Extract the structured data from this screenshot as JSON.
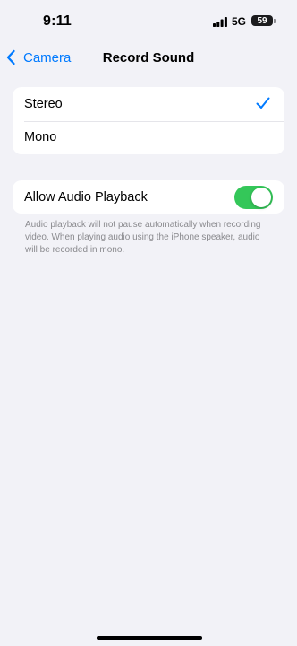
{
  "status_bar": {
    "time": "9:11",
    "network": "5G",
    "battery_level": "59",
    "icons": [
      "signal-bars-icon",
      "battery-icon"
    ]
  },
  "nav": {
    "back_label": "Camera",
    "back_icon": "chevron-left-icon",
    "title": "Record Sound"
  },
  "sound_options": {
    "items": [
      {
        "label": "Stereo",
        "selected": true
      },
      {
        "label": "Mono",
        "selected": false
      }
    ],
    "selected_icon": "checkmark-icon"
  },
  "audio_playback": {
    "label": "Allow Audio Playback",
    "enabled": true,
    "footer": "Audio playback will not pause automatically when recording video. When playing audio using the iPhone speaker, audio will be recorded in mono."
  },
  "colors": {
    "background": "#f2f2f7",
    "accent": "#007aff",
    "toggle_on": "#34c759",
    "secondary_text": "#8a8a8e"
  }
}
